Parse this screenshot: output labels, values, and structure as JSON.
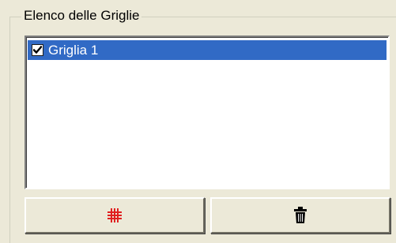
{
  "group": {
    "title": "Elenco delle Griglie"
  },
  "list": {
    "items": [
      {
        "label": "Griglia 1",
        "checked": true,
        "selected": true
      }
    ]
  },
  "buttons": {
    "add_grid": {
      "icon": "grid-icon",
      "color": "#e02020"
    },
    "delete": {
      "icon": "trash-icon",
      "color": "#000000"
    }
  },
  "colors": {
    "background": "#ece9d8",
    "selection": "#316ac5",
    "selection_text": "#ffffff"
  }
}
